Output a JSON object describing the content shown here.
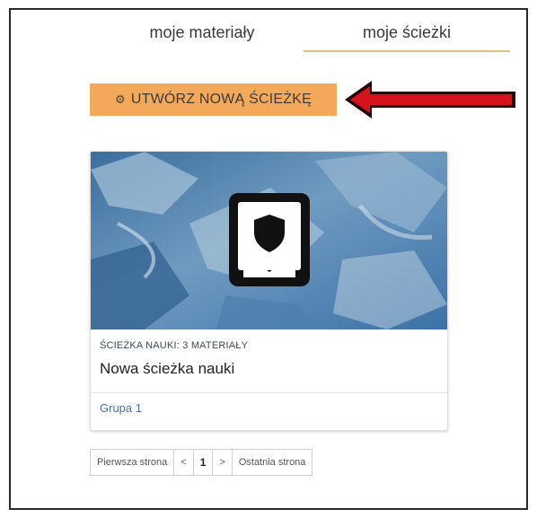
{
  "tabs": {
    "materials": "moje materiały",
    "paths": "moje ścieżki"
  },
  "create_button": {
    "icon": "path-icon",
    "label": "UTWÓRZ NOWĄ ŚCIEŻKĘ"
  },
  "card": {
    "type_label": "ŚCIEŻKA NAUKI: 3 MATERIAŁY",
    "title": "Nowa ścieżka nauki",
    "group": "Grupa 1",
    "icon": "shield-book-icon"
  },
  "pagination": {
    "first": "Pierwsza strona",
    "prev": "<",
    "current": "1",
    "next": ">",
    "last": "Ostatnia strona"
  },
  "colors": {
    "button_bg": "#f4a95a",
    "active_tab_underline": "#e3c07a",
    "arrow": "#d4141a",
    "group_link": "#4a6fa0"
  }
}
